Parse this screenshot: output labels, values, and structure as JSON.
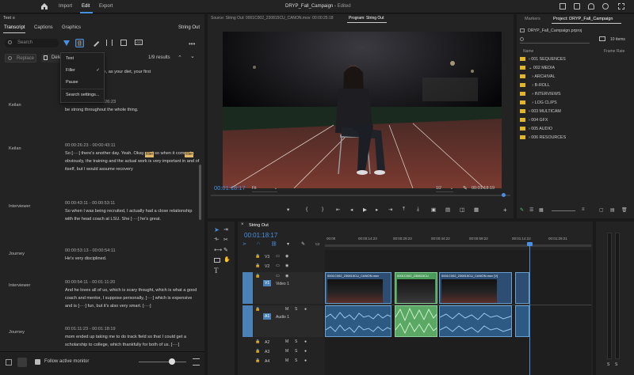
{
  "app": {
    "tabs": [
      "Import",
      "Edit",
      "Export"
    ],
    "active_tab": "Edit",
    "title": "DRYP_Fall_Campaign",
    "subtitle": "Edited"
  },
  "text_panel": {
    "title": "Text",
    "tabs": [
      "Transcript",
      "Captions",
      "Graphics"
    ],
    "sequence": "String Out",
    "search_placeholder": "Search",
    "replace_label": "Replace",
    "delete_label": "Dele",
    "results": "1/9 results",
    "menu": [
      "Text",
      "Filler",
      "Pause",
      "Search settings..."
    ],
    "follow_label": "Follow active monitor"
  },
  "transcript": [
    {
      "speaker": "",
      "time": "",
      "text": "of rely on as your life, as your diet, your first"
    },
    {
      "speaker": "Keilan",
      "time": "00:00:25:18 - 00:00:26:23",
      "text": "be strong throughout the whole thing."
    },
    {
      "speaker": "Keilan",
      "time": "00:00:26:23 - 00:00:43:11",
      "text": "So [····] there's another day. Yeah. Okay. and so when it comes to obviously, the training and the actual work is very important in and of itself, but I would assume recovery"
    },
    {
      "speaker": "Interviewer",
      "time": "00:00:43:11 - 00:00:53:11",
      "text": "So when I was being recruited, I actually had a close relationship with the head coach at LSU. She [····] he's great."
    },
    {
      "speaker": "Journey",
      "time": "00:00:53:13 - 00:00:54:11",
      "text": "He's very disciplined."
    },
    {
      "speaker": "Interviewer",
      "time": "00:00:54:11 - 00:01:11:20",
      "text": "And he loves all of us, which is scary thought, which is what a good coach and mentor, I suppose personally, [····] which is expensive and is [····] fun, but it's also very smart. [····]"
    },
    {
      "speaker": "Journey",
      "time": "00:01:11:23 - 00:01:18:19",
      "text": "mom ended up taking me to do track field so that I could get a scholarship to college, which thankfully for both of us. [····]"
    }
  ],
  "filler_word": "filler",
  "program": {
    "source_label": "Source: String Out: 0001C002_230815CU_CANON.mov: 00:00:25:18",
    "program_label": "Program: String Out",
    "timecode": "00:01:18:17",
    "fit": "Fit",
    "ratio": "1/2",
    "end_time": "00:01:18:19"
  },
  "project": {
    "markers_tab": "Markers",
    "project_tab": "Project: DRYP_Fall_Campaign",
    "file": "DRYP_Fall_Campaign.prproj",
    "count": "10 items",
    "col_name": "Name",
    "col_rate": "Frame Rate",
    "items": [
      "001 SEQUENCES",
      "002 MEDIA",
      "ARCHIVAL",
      "B-ROLL",
      "INTERVIEWS",
      "LOG CLIPS",
      "003 MULTICAM",
      "004 GFX",
      "005 AUDIO",
      "006 RESOURCES"
    ]
  },
  "timeline": {
    "seq_tab": "String Out",
    "timecode": "00:01:18:17",
    "ruler": [
      "00:00",
      "00:00:14:23",
      "00:00:29:23",
      "00:00:44:22",
      "00:00:59:22",
      "00:01:14:22",
      "00:01:29:21"
    ],
    "video_tracks": [
      "V3",
      "V2",
      "V1"
    ],
    "audio_tracks": [
      "A1",
      "A2",
      "A3",
      "A4"
    ],
    "v1_label": "Video 1",
    "a1_label": "Audio 1",
    "clip_names": [
      "0001C002_230815CU_CANON.mov",
      "0001C002_230815CU",
      "0001C002_230815CU_CANON.mov [V]"
    ]
  },
  "colors": {
    "accent": "#4a90e2",
    "highlight": "#e2b86a",
    "audio": "#66c97a",
    "folder": "#e3b52a"
  }
}
